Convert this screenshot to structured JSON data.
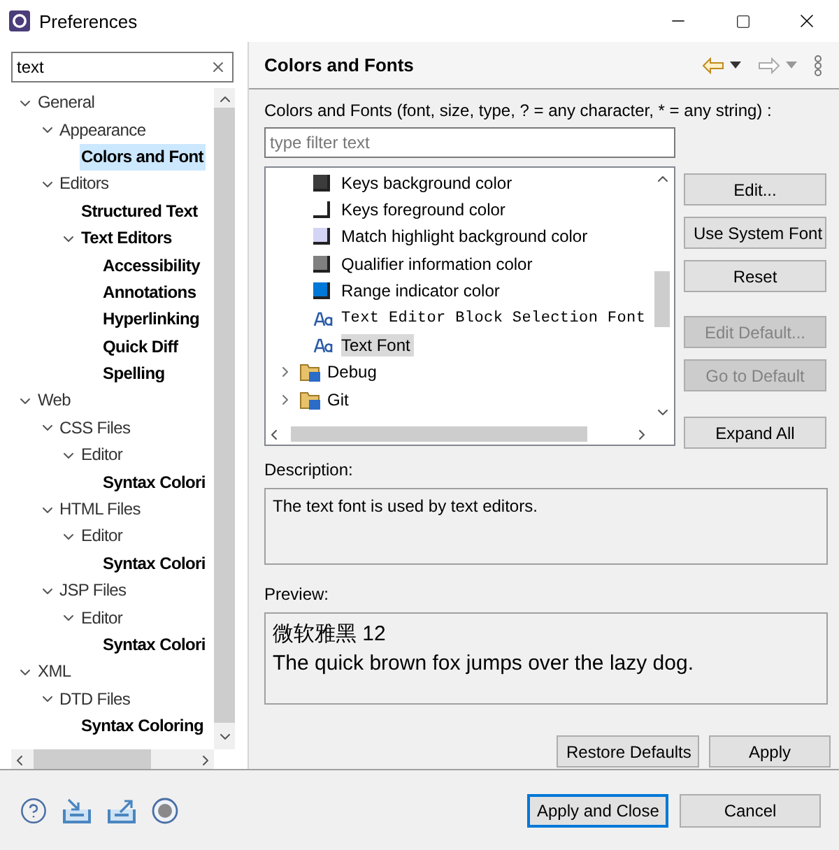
{
  "window": {
    "title": "Preferences"
  },
  "sidebar": {
    "search": {
      "value": "text"
    },
    "tree": [
      {
        "label": "General",
        "selected": false,
        "match": false,
        "expanded": true,
        "children": [
          {
            "label": "Appearance",
            "selected": false,
            "match": false,
            "expanded": true,
            "children": [
              {
                "label": "Colors and Font",
                "selected": true,
                "match": true
              }
            ]
          },
          {
            "label": "Editors",
            "selected": false,
            "match": false,
            "expanded": true,
            "children": [
              {
                "label": "Structured Text",
                "selected": false,
                "match": true
              },
              {
                "label": "Text Editors",
                "selected": false,
                "match": true,
                "expanded": true,
                "children": [
                  {
                    "label": "Accessibility",
                    "selected": false,
                    "match": true
                  },
                  {
                    "label": "Annotations",
                    "selected": false,
                    "match": true
                  },
                  {
                    "label": "Hyperlinking",
                    "selected": false,
                    "match": true
                  },
                  {
                    "label": "Quick Diff",
                    "selected": false,
                    "match": true
                  },
                  {
                    "label": "Spelling",
                    "selected": false,
                    "match": true
                  }
                ]
              }
            ]
          }
        ]
      },
      {
        "label": "Web",
        "selected": false,
        "match": false,
        "expanded": true,
        "children": [
          {
            "label": "CSS Files",
            "selected": false,
            "match": false,
            "expanded": true,
            "children": [
              {
                "label": "Editor",
                "selected": false,
                "match": false,
                "expanded": true,
                "children": [
                  {
                    "label": "Syntax Colori",
                    "selected": false,
                    "match": true
                  }
                ]
              }
            ]
          },
          {
            "label": "HTML Files",
            "selected": false,
            "match": false,
            "expanded": true,
            "children": [
              {
                "label": "Editor",
                "selected": false,
                "match": false,
                "expanded": true,
                "children": [
                  {
                    "label": "Syntax Colori",
                    "selected": false,
                    "match": true
                  }
                ]
              }
            ]
          },
          {
            "label": "JSP Files",
            "selected": false,
            "match": false,
            "expanded": true,
            "children": [
              {
                "label": "Editor",
                "selected": false,
                "match": false,
                "expanded": true,
                "children": [
                  {
                    "label": "Syntax Colori",
                    "selected": false,
                    "match": true
                  }
                ]
              }
            ]
          }
        ]
      },
      {
        "label": "XML",
        "selected": false,
        "match": false,
        "expanded": true,
        "children": [
          {
            "label": "DTD Files",
            "selected": false,
            "match": false,
            "expanded": true,
            "children": [
              {
                "label": "Syntax Coloring",
                "selected": false,
                "match": true
              }
            ]
          }
        ]
      }
    ]
  },
  "page": {
    "title": "Colors and Fonts",
    "filter_label": "Colors and Fonts (font, size, type, ? = any character, * = any string) :",
    "filter": {
      "placeholder": "type filter text"
    },
    "items": [
      {
        "kind": "color",
        "label": "Keys background color",
        "color": "#3c3c3c",
        "selected": false
      },
      {
        "kind": "color",
        "label": "Keys foreground color",
        "color": "#ffffff",
        "selected": false
      },
      {
        "kind": "color",
        "label": "Match highlight background color",
        "color": "#d4d4f4",
        "selected": false
      },
      {
        "kind": "color",
        "label": "Qualifier information color",
        "color": "#808080",
        "selected": false
      },
      {
        "kind": "color",
        "label": "Range indicator color",
        "color": "#0078d7",
        "selected": false
      },
      {
        "kind": "mono-font",
        "label": "Text Editor Block Selection Font",
        "selected": false
      },
      {
        "kind": "font",
        "label": "Text Font",
        "selected": true
      },
      {
        "kind": "category",
        "label": "Debug",
        "expanded": false,
        "selected": false
      },
      {
        "kind": "category",
        "label": "Git",
        "expanded": false,
        "selected": false
      }
    ],
    "side_buttons": [
      {
        "label": "Edit...",
        "disabled": false
      },
      {
        "label": "Use System Font",
        "disabled": false
      },
      {
        "label": "Reset",
        "disabled": false
      },
      {
        "label": "Edit Default...",
        "disabled": true
      },
      {
        "label": "Go to Default",
        "disabled": true
      },
      {
        "label": "Expand All",
        "disabled": false
      }
    ],
    "description_label": "Description:",
    "description": "The text font is used by text editors.",
    "preview_label": "Preview:",
    "preview": [
      "微软雅黑 12",
      "The quick brown fox jumps over the lazy dog."
    ],
    "buttons": [
      "Restore Defaults",
      "Apply"
    ]
  },
  "footer": {
    "buttons": [
      {
        "label": "Apply and Close",
        "default": true
      },
      {
        "label": "Cancel",
        "default": false
      }
    ]
  }
}
